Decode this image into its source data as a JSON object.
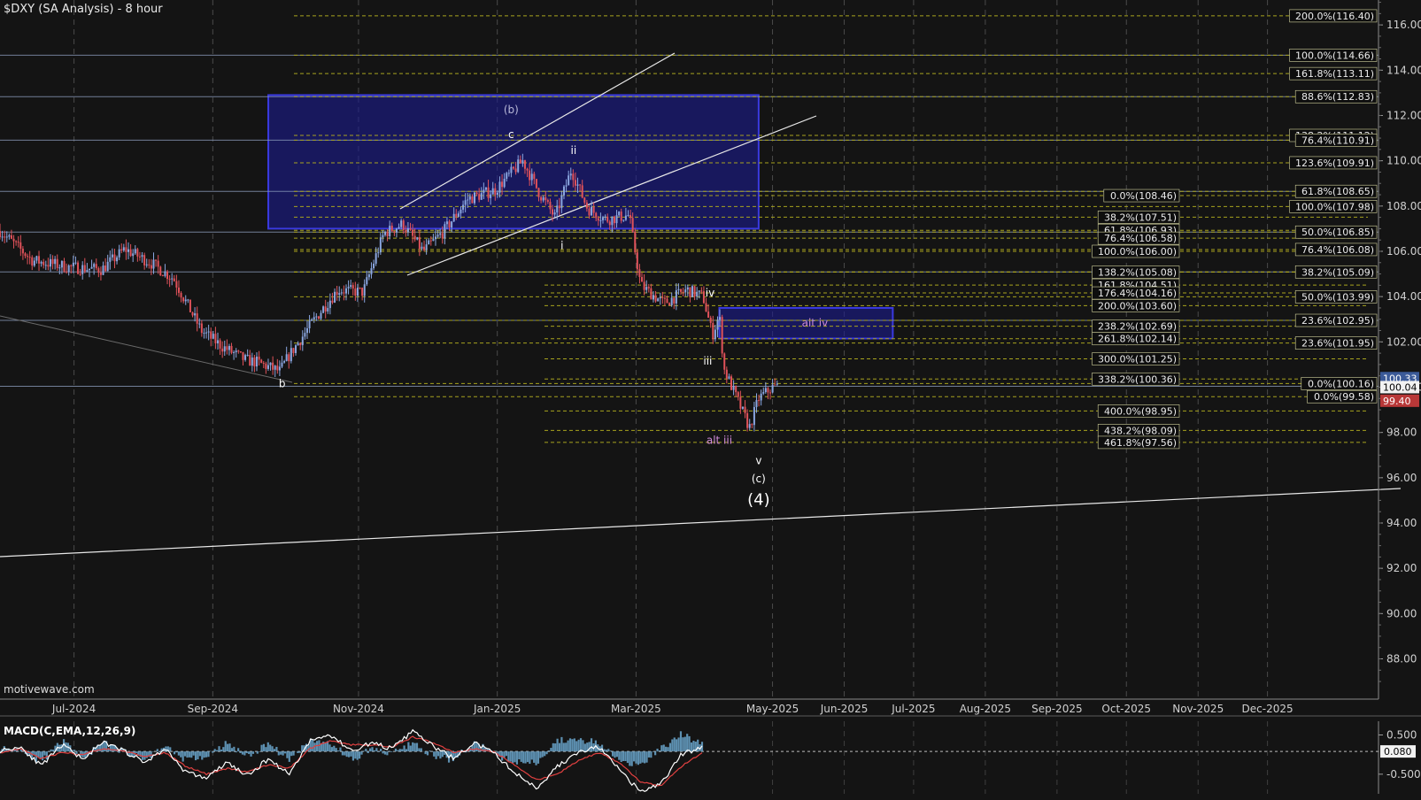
{
  "title": "$DXY (SA Analysis) - 8 hour",
  "brand": "motivewave.com",
  "macd_title": "MACD(C,EMA,12,26,9)",
  "colors": {
    "background": "#141414",
    "up_candle": "#8aa6e0",
    "down_candle": "#e0525a",
    "hline": "#8898b8",
    "fib_line": "#a7a21e",
    "zone_fill": "#1c1c8a",
    "zone_border": "#3a3ae0",
    "macd_line": "#ffffff",
    "signal_line": "#e04040",
    "histogram": "#6aa6cc",
    "price_tag_red": "#b83838"
  },
  "chart_data": [
    {
      "type": "candlestick",
      "title": "$DXY (SA Analysis) - 8 hour",
      "x_ticks": [
        "Jul-2024",
        "Sep-2024",
        "Nov-2024",
        "Jan-2025",
        "Mar-2025",
        "May-2025",
        "Jun-2025",
        "Jul-2025",
        "Aug-2025",
        "Sep-2025",
        "Oct-2025",
        "Nov-2025",
        "Dec-2025"
      ],
      "y_ticks": [
        "116.00",
        "114.00",
        "112.00",
        "110.00",
        "108.00",
        "106.00",
        "104.00",
        "102.00",
        "100.00",
        "98.00",
        "96.00",
        "94.00",
        "92.00",
        "90.00",
        "88.00"
      ],
      "ylim": [
        87,
        117.8
      ],
      "price_path": [
        [
          "2024-06-01",
          106.9
        ],
        [
          "2024-06-15",
          105.6
        ],
        [
          "2024-07-01",
          105.3
        ],
        [
          "2024-07-15",
          105.2
        ],
        [
          "2024-07-25",
          106.1
        ],
        [
          "2024-08-05",
          105.5
        ],
        [
          "2024-08-15",
          104.8
        ],
        [
          "2024-08-27",
          102.5
        ],
        [
          "2024-09-05",
          101.8
        ],
        [
          "2024-09-15",
          101.2
        ],
        [
          "2024-09-20",
          101.1
        ],
        [
          "2024-09-30",
          100.7
        ],
        [
          "2024-10-04",
          101.4
        ],
        [
          "2024-10-15",
          103.0
        ],
        [
          "2024-10-25",
          104.3
        ],
        [
          "2024-11-05",
          104.2
        ],
        [
          "2024-11-14",
          106.8
        ],
        [
          "2024-11-22",
          107.2
        ],
        [
          "2024-12-01",
          106.0
        ],
        [
          "2024-12-10",
          106.9
        ],
        [
          "2024-12-20",
          108.3
        ],
        [
          "2025-01-01",
          108.7
        ],
        [
          "2025-01-13",
          110.0
        ],
        [
          "2025-01-20",
          108.6
        ],
        [
          "2025-01-27",
          107.5
        ],
        [
          "2025-02-03",
          109.6
        ],
        [
          "2025-02-10",
          107.9
        ],
        [
          "2025-02-18",
          107.4
        ],
        [
          "2025-02-28",
          107.6
        ],
        [
          "2025-03-05",
          104.5
        ],
        [
          "2025-03-15",
          103.7
        ],
        [
          "2025-03-25",
          104.3
        ],
        [
          "2025-04-01",
          104.0
        ],
        [
          "2025-04-05",
          102.3
        ],
        [
          "2025-04-08",
          103.2
        ],
        [
          "2025-04-10",
          100.8
        ],
        [
          "2025-04-16",
          99.4
        ],
        [
          "2025-04-21",
          98.2
        ],
        [
          "2025-04-25",
          99.5
        ],
        [
          "2025-05-01",
          100.0
        ],
        [
          "2025-05-04",
          100.04
        ]
      ],
      "last_price": "100.04",
      "price_tags": [
        "100.33",
        "100.04",
        "99.40"
      ],
      "horizontal_levels": [
        114.66,
        112.83,
        110.91,
        108.65,
        106.85,
        105.09,
        102.95,
        100.04
      ],
      "fib_levels": [
        {
          "label": "200.0%(116.40)",
          "value": 116.4
        },
        {
          "label": "100.0%(114.66)",
          "value": 114.66
        },
        {
          "label": "161.8%(113.11)",
          "value": 113.85
        },
        {
          "label": "88.6%(112.83)",
          "value": 112.83
        },
        {
          "label": "138.2%(111.12)",
          "value": 111.12
        },
        {
          "label": "76.4%(110.91)",
          "value": 110.91
        },
        {
          "label": "123.6%(109.91)",
          "value": 109.91
        },
        {
          "label": "0.0%(108.46)",
          "value": 108.46
        },
        {
          "label": "61.8%(108.65)",
          "value": 108.65
        },
        {
          "label": "100.0%(107.98)",
          "value": 107.98
        },
        {
          "label": "38.2%(107.51)",
          "value": 107.51
        },
        {
          "label": "61.8%(106.93)",
          "value": 106.93
        },
        {
          "label": "50.0%(106.85)",
          "value": 106.85
        },
        {
          "label": "76.4%(106.58)",
          "value": 106.58
        },
        {
          "label": "100.0%(106.00)",
          "value": 106.0
        },
        {
          "label": "76.4%(106.08)",
          "value": 106.08
        },
        {
          "label": "138.2%(105.08)",
          "value": 105.08
        },
        {
          "label": "38.2%(105.09)",
          "value": 105.09
        },
        {
          "label": "161.8%(104.51)",
          "value": 104.51
        },
        {
          "label": "176.4%(104.16)",
          "value": 104.16
        },
        {
          "label": "50.0%(103.99)",
          "value": 103.99
        },
        {
          "label": "200.0%(103.60)",
          "value": 103.6
        },
        {
          "label": "23.6%(102.95)",
          "value": 102.95
        },
        {
          "label": "238.2%(102.69)",
          "value": 102.69
        },
        {
          "label": "261.8%(102.14)",
          "value": 102.14
        },
        {
          "label": "23.6%(101.95)",
          "value": 101.95
        },
        {
          "label": "300.0%(101.25)",
          "value": 101.25
        },
        {
          "label": "338.2%(100.36)",
          "value": 100.36
        },
        {
          "label": "0.0%(100.16)",
          "value": 100.16
        },
        {
          "label": "0.0%(99.58)",
          "value": 99.58
        },
        {
          "label": "400.0%(98.95)",
          "value": 98.95
        },
        {
          "label": "438.2%(98.09)",
          "value": 98.09
        },
        {
          "label": "461.8%(97.56)",
          "value": 97.56
        }
      ],
      "zones": [
        {
          "from": "2024-09-25",
          "to": "2025-04-25",
          "low": 107.0,
          "high": 112.9
        },
        {
          "from": "2025-04-08",
          "to": "2025-06-22",
          "low": 102.15,
          "high": 103.5,
          "label": "alt iv"
        }
      ],
      "wave_labels": [
        {
          "text": "(b)",
          "date": "2025-01-08",
          "price": 112.1
        },
        {
          "text": "c",
          "date": "2025-01-08",
          "price": 111.0
        },
        {
          "text": "ii",
          "date": "2025-02-04",
          "price": 110.3
        },
        {
          "text": "i",
          "date": "2025-01-30",
          "price": 106.1
        },
        {
          "text": "b",
          "date": "2024-10-01",
          "price": 100.0
        },
        {
          "text": "iv",
          "date": "2025-04-04",
          "price": 104.0
        },
        {
          "text": "iii",
          "date": "2025-04-03",
          "price": 101.0
        },
        {
          "text": "alt iii",
          "date": "2025-04-08",
          "price": 97.5
        },
        {
          "text": "v",
          "date": "2025-04-25",
          "price": 96.6
        },
        {
          "text": "(c)",
          "date": "2025-04-25",
          "price": 95.8
        },
        {
          "text": "(4)",
          "date": "2025-04-25",
          "price": 94.8
        }
      ]
    },
    {
      "type": "line",
      "title": "MACD(C,EMA,12,26,9)",
      "y_ticks": [
        "0.500",
        "-0.500"
      ],
      "ylim": [
        -1.0,
        0.85
      ],
      "last_value": "0.080",
      "series": [
        {
          "name": "MACD",
          "values": [
            0.1,
            0.2,
            -0.3,
            0.25,
            -0.1,
            0.3,
            0.1,
            -0.2,
            0.15,
            -0.45,
            -0.6,
            -0.2,
            -0.55,
            -0.1,
            -0.5,
            0.35,
            0.5,
            0.1,
            0.3,
            0.15,
            0.6,
            0.2,
            -0.1,
            0.3,
            0.0,
            -0.5,
            -0.85,
            -0.3,
            0.05,
            0.2,
            -0.4,
            -0.95,
            -0.75,
            0.0,
            0.2
          ]
        },
        {
          "name": "Signal",
          "values": [
            0.05,
            0.15,
            -0.1,
            0.05,
            0.0,
            0.15,
            0.1,
            -0.05,
            0.05,
            -0.3,
            -0.5,
            -0.35,
            -0.45,
            -0.25,
            -0.35,
            0.15,
            0.35,
            0.25,
            0.25,
            0.2,
            0.45,
            0.3,
            0.05,
            0.15,
            0.05,
            -0.3,
            -0.65,
            -0.5,
            -0.15,
            0.05,
            -0.2,
            -0.7,
            -0.8,
            -0.3,
            0.05
          ]
        }
      ]
    }
  ]
}
